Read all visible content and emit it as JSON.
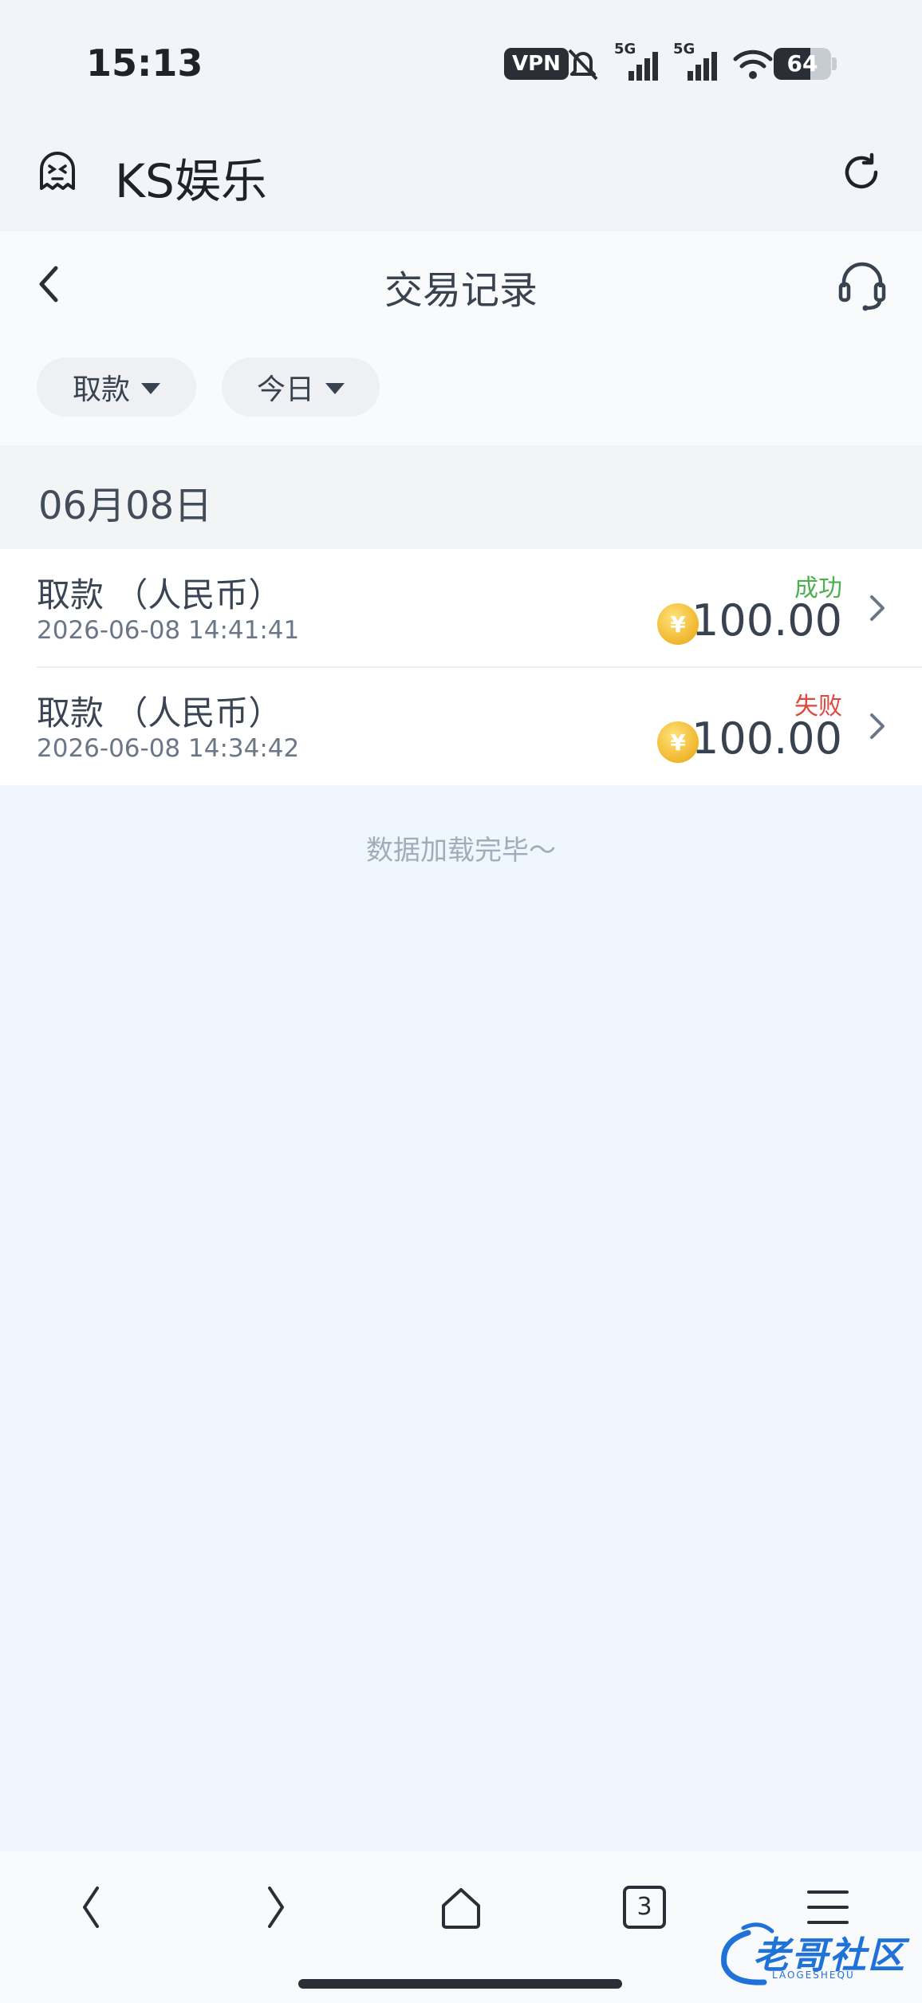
{
  "status_bar": {
    "time": "15:13",
    "vpn_label": "VPN",
    "network_1": "5G",
    "network_2": "5G",
    "battery_level": "64",
    "battery_fraction": 0.64,
    "icons": [
      "mute-icon",
      "signal-icon",
      "signal-icon",
      "wifi-icon",
      "battery-icon"
    ]
  },
  "app_header": {
    "title": "KS娱乐",
    "logo_icon": "ghost-logo-icon",
    "refresh_icon": "refresh-icon"
  },
  "page": {
    "title": "交易记录",
    "back_icon": "chevron-left-icon",
    "service_icon": "headset-icon"
  },
  "filters": {
    "type_label": "取款",
    "range_label": "今日"
  },
  "list": {
    "date_header": "06月08日",
    "rows": [
      {
        "title": "取款 （人民币）",
        "datetime": "2026-06-08 14:41:41",
        "status": "成功",
        "status_color": "#4caf50",
        "amount": "100.00"
      },
      {
        "title": "取款 （人民币）",
        "datetime": "2026-06-08 14:34:42",
        "status": "失败",
        "status_color": "#e0473c",
        "amount": "100.00"
      }
    ],
    "coin_symbol": "¥",
    "end_text": "数据加载完毕～"
  },
  "browser_bar": {
    "tab_count": "3",
    "icons": [
      "back-icon",
      "forward-icon",
      "home-icon",
      "tabs-icon",
      "menu-icon"
    ]
  },
  "watermark": {
    "text": "老哥社区",
    "subtext": "LAOGESHEQU"
  },
  "colors": {
    "background": "#eff6fd",
    "success": "#4caf50",
    "failure": "#e0473c",
    "watermark": "#1f72d8"
  }
}
